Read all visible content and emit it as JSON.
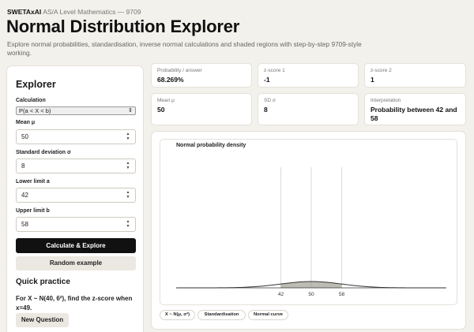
{
  "header": {
    "brand": "SWETAxAI",
    "course": "AS/A Level Mathematics — 9709",
    "title": "Normal Distribution Explorer",
    "description": "Explore normal probabilities, standardisation, inverse normal calculations and shaded regions with step-by-step 9709-style working."
  },
  "explorer": {
    "heading": "Explorer",
    "calculation_label": "Calculation",
    "calculation_value": "P(a < X < b)",
    "mean_label": "Mean μ",
    "mean_value": "50",
    "sd_label": "Standard deviation σ",
    "sd_value": "8",
    "lower_label": "Lower limit a",
    "lower_value": "42",
    "upper_label": "Upper limit b",
    "upper_value": "58",
    "calculate_button": "Calculate & Explore",
    "random_button": "Random example"
  },
  "practice": {
    "heading": "Quick practice",
    "question": "For X ~ N(40, 6²), find the z-score when x=49.",
    "new_question_button": "New Question"
  },
  "stats": {
    "probability_label": "Probability / answer",
    "probability_value": "68.269%",
    "z1_label": "z-score 1",
    "z1_value": "-1",
    "z2_label": "z-score 2",
    "z2_value": "1",
    "mean_label": "Mean μ",
    "mean_value": "50",
    "sd_label": "SD σ",
    "sd_value": "8",
    "interp_label": "Interpretation",
    "interp_value": "Probability between 42 and 58"
  },
  "chart_tabs": [
    "X ~ N(μ, σ²)",
    "Standardisation",
    "Normal curve"
  ],
  "chart_data": {
    "type": "area",
    "title": "Normal probability density",
    "mean": 50,
    "sd": 8,
    "shade_from": 42,
    "shade_to": 58,
    "x_ticks": [
      42,
      50,
      58
    ],
    "colors": {
      "curve": "#333333",
      "shade": "#8f8f83",
      "guide": "#d0d0d0"
    }
  }
}
